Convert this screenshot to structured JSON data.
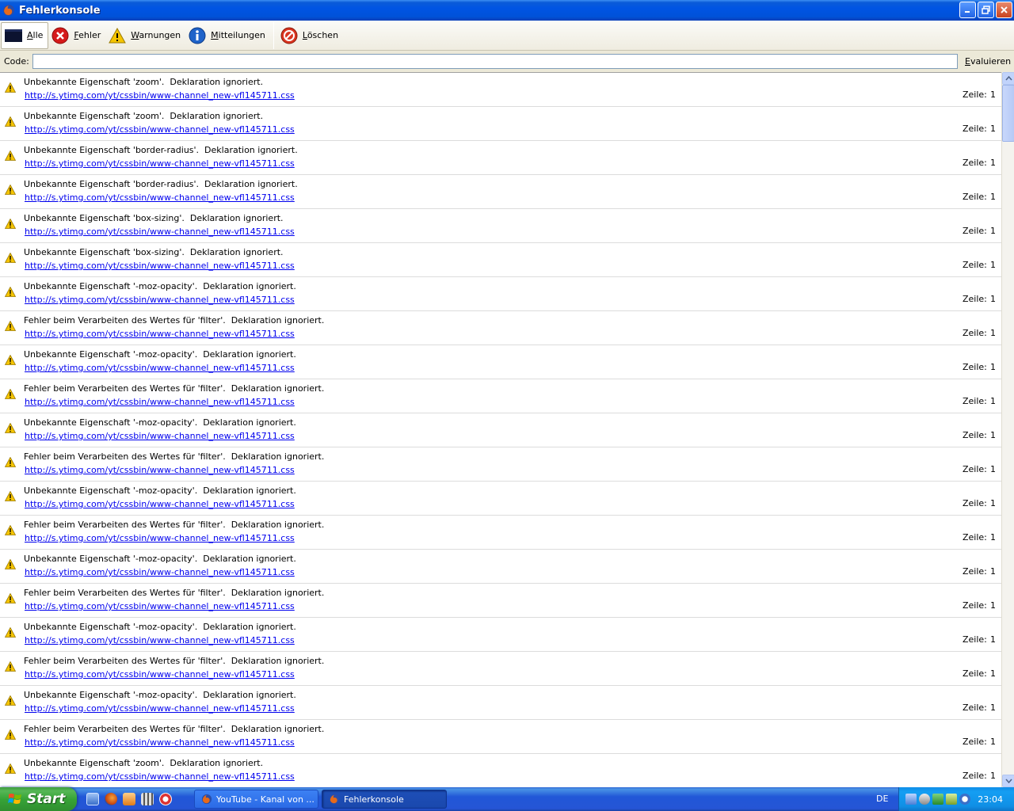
{
  "window": {
    "title": "Fehlerkonsole"
  },
  "toolbar": {
    "buttons": [
      {
        "label": "Alle",
        "icon": "console-icon",
        "active": true
      },
      {
        "label": "Fehler",
        "icon": "error-icon",
        "active": false
      },
      {
        "label": "Warnungen",
        "icon": "warning-icon",
        "active": false
      },
      {
        "label": "Mitteilungen",
        "icon": "info-icon",
        "active": false
      },
      {
        "label": "Löschen",
        "icon": "clear-icon",
        "active": false
      }
    ]
  },
  "codebar": {
    "label": "Code:",
    "value": "",
    "evaluate_label": "Evaluieren"
  },
  "messages": [
    {
      "text": "Unbekannte Eigenschaft 'zoom'.  Deklaration ignoriert.",
      "url": "http://s.ytimg.com/yt/cssbin/www-channel_new-vfl145711.css",
      "line_label": "Zeile:",
      "line": "1"
    },
    {
      "text": "Unbekannte Eigenschaft 'zoom'.  Deklaration ignoriert.",
      "url": "http://s.ytimg.com/yt/cssbin/www-channel_new-vfl145711.css",
      "line_label": "Zeile:",
      "line": "1"
    },
    {
      "text": "Unbekannte Eigenschaft 'border-radius'.  Deklaration ignoriert.",
      "url": "http://s.ytimg.com/yt/cssbin/www-channel_new-vfl145711.css",
      "line_label": "Zeile:",
      "line": "1"
    },
    {
      "text": "Unbekannte Eigenschaft 'border-radius'.  Deklaration ignoriert.",
      "url": "http://s.ytimg.com/yt/cssbin/www-channel_new-vfl145711.css",
      "line_label": "Zeile:",
      "line": "1"
    },
    {
      "text": "Unbekannte Eigenschaft 'box-sizing'.  Deklaration ignoriert.",
      "url": "http://s.ytimg.com/yt/cssbin/www-channel_new-vfl145711.css",
      "line_label": "Zeile:",
      "line": "1"
    },
    {
      "text": "Unbekannte Eigenschaft 'box-sizing'.  Deklaration ignoriert.",
      "url": "http://s.ytimg.com/yt/cssbin/www-channel_new-vfl145711.css",
      "line_label": "Zeile:",
      "line": "1"
    },
    {
      "text": "Unbekannte Eigenschaft '-moz-opacity'.  Deklaration ignoriert.",
      "url": "http://s.ytimg.com/yt/cssbin/www-channel_new-vfl145711.css",
      "line_label": "Zeile:",
      "line": "1"
    },
    {
      "text": "Fehler beim Verarbeiten des Wertes für 'filter'.  Deklaration ignoriert.",
      "url": "http://s.ytimg.com/yt/cssbin/www-channel_new-vfl145711.css",
      "line_label": "Zeile:",
      "line": "1"
    },
    {
      "text": "Unbekannte Eigenschaft '-moz-opacity'.  Deklaration ignoriert.",
      "url": "http://s.ytimg.com/yt/cssbin/www-channel_new-vfl145711.css",
      "line_label": "Zeile:",
      "line": "1"
    },
    {
      "text": "Fehler beim Verarbeiten des Wertes für 'filter'.  Deklaration ignoriert.",
      "url": "http://s.ytimg.com/yt/cssbin/www-channel_new-vfl145711.css",
      "line_label": "Zeile:",
      "line": "1"
    },
    {
      "text": "Unbekannte Eigenschaft '-moz-opacity'.  Deklaration ignoriert.",
      "url": "http://s.ytimg.com/yt/cssbin/www-channel_new-vfl145711.css",
      "line_label": "Zeile:",
      "line": "1"
    },
    {
      "text": "Fehler beim Verarbeiten des Wertes für 'filter'.  Deklaration ignoriert.",
      "url": "http://s.ytimg.com/yt/cssbin/www-channel_new-vfl145711.css",
      "line_label": "Zeile:",
      "line": "1"
    },
    {
      "text": "Unbekannte Eigenschaft '-moz-opacity'.  Deklaration ignoriert.",
      "url": "http://s.ytimg.com/yt/cssbin/www-channel_new-vfl145711.css",
      "line_label": "Zeile:",
      "line": "1"
    },
    {
      "text": "Fehler beim Verarbeiten des Wertes für 'filter'.  Deklaration ignoriert.",
      "url": "http://s.ytimg.com/yt/cssbin/www-channel_new-vfl145711.css",
      "line_label": "Zeile:",
      "line": "1"
    },
    {
      "text": "Unbekannte Eigenschaft '-moz-opacity'.  Deklaration ignoriert.",
      "url": "http://s.ytimg.com/yt/cssbin/www-channel_new-vfl145711.css",
      "line_label": "Zeile:",
      "line": "1"
    },
    {
      "text": "Fehler beim Verarbeiten des Wertes für 'filter'.  Deklaration ignoriert.",
      "url": "http://s.ytimg.com/yt/cssbin/www-channel_new-vfl145711.css",
      "line_label": "Zeile:",
      "line": "1"
    },
    {
      "text": "Unbekannte Eigenschaft '-moz-opacity'.  Deklaration ignoriert.",
      "url": "http://s.ytimg.com/yt/cssbin/www-channel_new-vfl145711.css",
      "line_label": "Zeile:",
      "line": "1"
    },
    {
      "text": "Fehler beim Verarbeiten des Wertes für 'filter'.  Deklaration ignoriert.",
      "url": "http://s.ytimg.com/yt/cssbin/www-channel_new-vfl145711.css",
      "line_label": "Zeile:",
      "line": "1"
    },
    {
      "text": "Unbekannte Eigenschaft '-moz-opacity'.  Deklaration ignoriert.",
      "url": "http://s.ytimg.com/yt/cssbin/www-channel_new-vfl145711.css",
      "line_label": "Zeile:",
      "line": "1"
    },
    {
      "text": "Fehler beim Verarbeiten des Wertes für 'filter'.  Deklaration ignoriert.",
      "url": "http://s.ytimg.com/yt/cssbin/www-channel_new-vfl145711.css",
      "line_label": "Zeile:",
      "line": "1"
    },
    {
      "text": "Unbekannte Eigenschaft 'zoom'.  Deklaration ignoriert.",
      "url": "http://s.ytimg.com/yt/cssbin/www-channel_new-vfl145711.css",
      "line_label": "Zeile:",
      "line": "1"
    }
  ],
  "taskbar": {
    "start_label": "Start",
    "quicklaunch": [
      "desktop-icon",
      "firefox-icon",
      "media-icon",
      "film-icon",
      "app-icon"
    ],
    "tasks": [
      {
        "label": "YouTube - Kanal von ...",
        "icon": "firefox-icon",
        "active": false
      },
      {
        "label": "Fehlerkonsole",
        "icon": "firefox-icon",
        "active": true
      }
    ],
    "language": "DE",
    "clock": "23:04"
  },
  "colors": {
    "titlebar": "#0054e3",
    "link": "#0000ee",
    "warning": "#f5c400",
    "taskbar": "#2555d6",
    "tray": "#108fe5",
    "start": "#37a337"
  }
}
